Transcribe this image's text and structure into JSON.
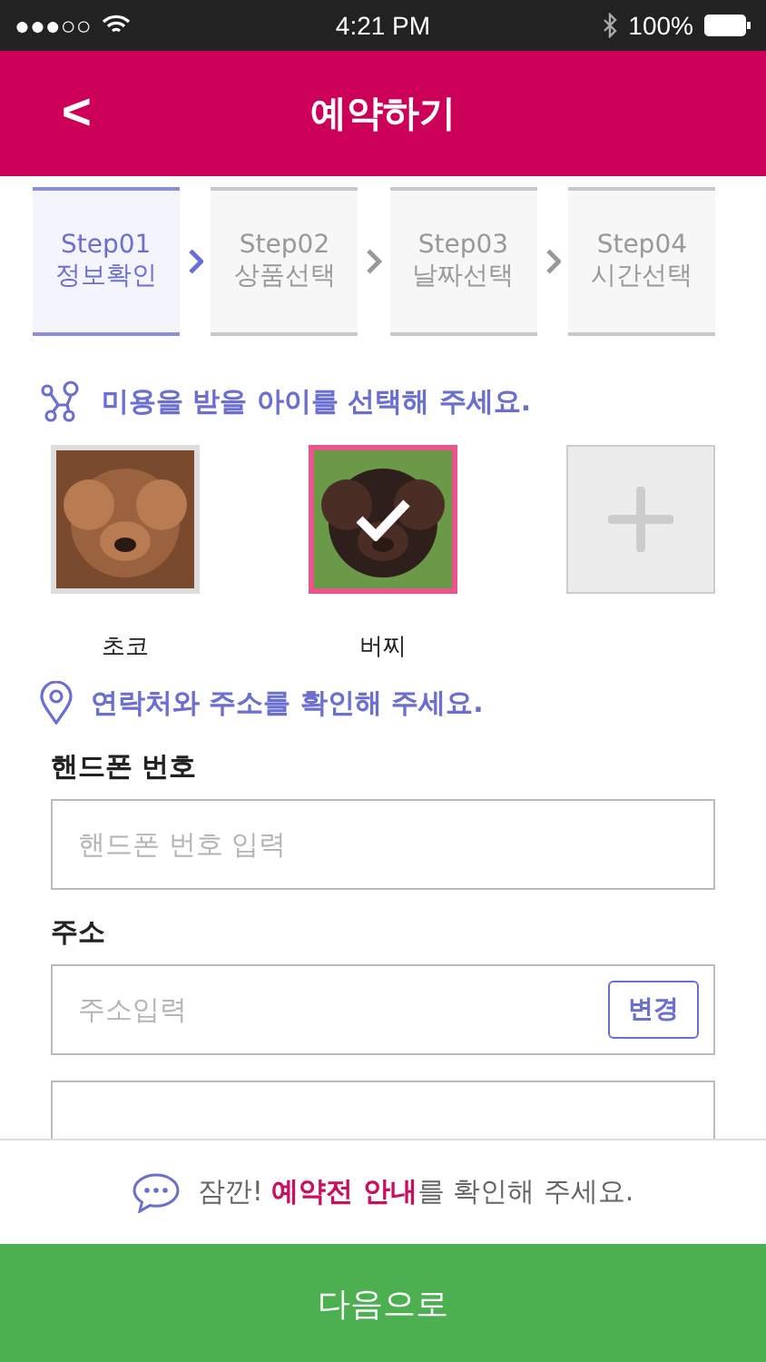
{
  "status_bar": {
    "signal": "●●●○○",
    "time": "4:21 PM",
    "battery": "100%"
  },
  "header": {
    "back": "<",
    "title": "예약하기"
  },
  "steps": [
    {
      "step": "Step01",
      "label": "정보확인",
      "selected": true
    },
    {
      "step": "Step02",
      "label": "상품선택",
      "selected": false
    },
    {
      "step": "Step03",
      "label": "날짜선택",
      "selected": false
    },
    {
      "step": "Step04",
      "label": "시간선택",
      "selected": false
    }
  ],
  "pet_section": {
    "title": "미용을 받을 아이를 선택해 주세요.",
    "pets": [
      {
        "name": "초코",
        "selected": false,
        "kind": "picture"
      },
      {
        "name": "버찌",
        "selected": true,
        "kind": "picture"
      }
    ]
  },
  "contact_section": {
    "title": "연락처와 주소를 확인해 주세요.",
    "phone_label": "핸드폰 번호",
    "phone_placeholder": "핸드폰 번호 입력",
    "address_label": "주소",
    "address_placeholder": "주소입력",
    "change_button": "변경"
  },
  "notice": "잠깐! **예약전 안내**를 확인해 주세요.",
  "next_button": "다음으로"
}
